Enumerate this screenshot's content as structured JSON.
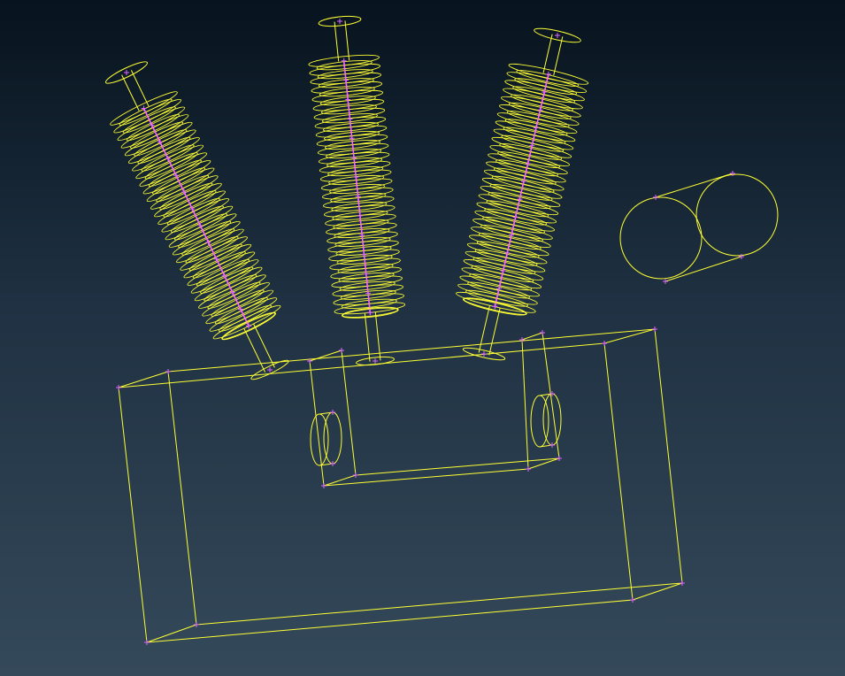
{
  "viewport": {
    "background_top": "#07131e",
    "background_bottom": "#34495a"
  },
  "colors": {
    "wireframe": "#ffff33",
    "vertex_marker": "#e066ff",
    "core_line": "#ff66ff"
  },
  "scene": {
    "objects": [
      "bushing-left",
      "bushing-center",
      "bushing-right",
      "tank-box",
      "tank-inner-frame",
      "tank-left-hole",
      "tank-right-hole",
      "double-cylinder"
    ]
  }
}
